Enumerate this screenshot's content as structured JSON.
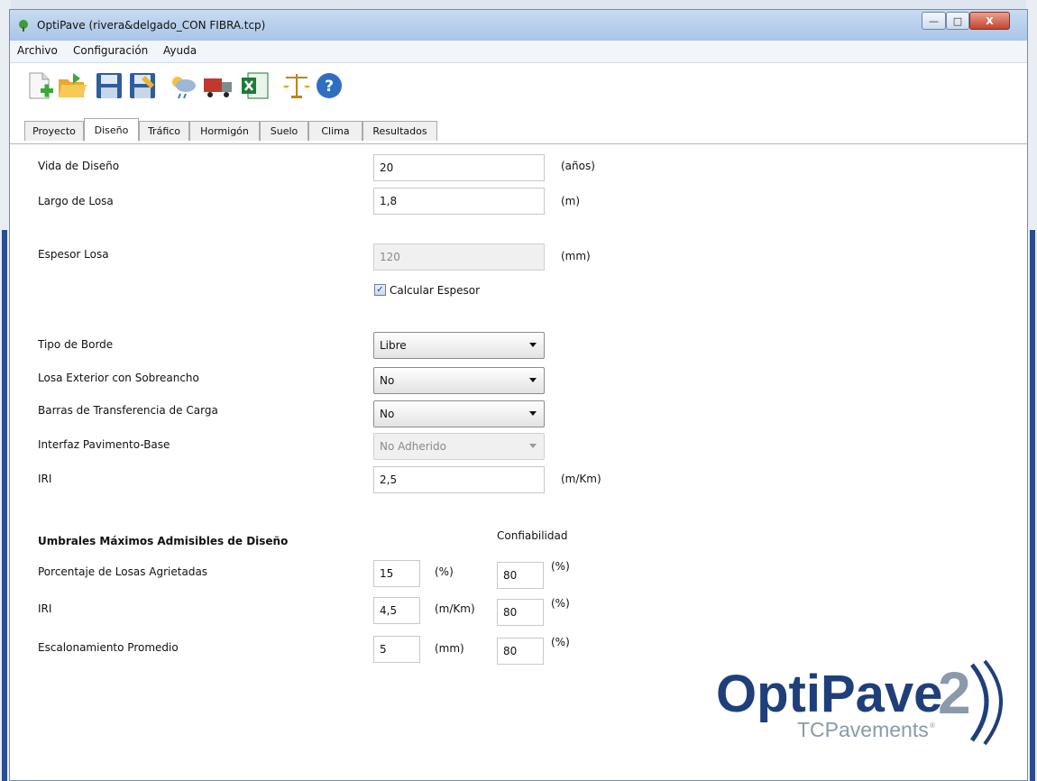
{
  "window": {
    "title": "OptiPave  (rivera&delgado_CON FIBRA.tcp)",
    "min": "—",
    "max": "□",
    "close": "X"
  },
  "menu": [
    "Archivo",
    "Configuración",
    "Ayuda"
  ],
  "toolbar": {
    "icons": [
      "new-file-icon",
      "open-folder-icon",
      "save-icon",
      "save-as-icon",
      "weather-icon",
      "truck-icon",
      "excel-icon",
      "scale-icon",
      "help-icon"
    ]
  },
  "tabs": [
    "Proyecto",
    "Diseño",
    "Tráfico",
    "Hormigón",
    "Suelo",
    "Clima",
    "Resultados"
  ],
  "active_tab": "Diseño",
  "design": {
    "vida": {
      "label": "Vida de Diseño",
      "value": "20",
      "unit": "(años)"
    },
    "largo": {
      "label": "Largo de Losa",
      "value": "1,8",
      "unit": "(m)"
    },
    "espesor": {
      "label": "Espesor Losa",
      "value": "120",
      "unit": "(mm)"
    },
    "calcular": {
      "label": "Calcular Espesor",
      "checked": true
    },
    "tipo_borde": {
      "label": "Tipo de Borde",
      "value": "Libre"
    },
    "sobreancho": {
      "label": "Losa Exterior con Sobreancho",
      "value": "No"
    },
    "barras": {
      "label": "Barras de Transferencia de Carga",
      "value": "No"
    },
    "interfaz": {
      "label": "Interfaz Pavimento-Base",
      "value": "No Adherido"
    },
    "iri": {
      "label": "IRI",
      "value": "2,5",
      "unit": "(m/Km)"
    }
  },
  "thresholds": {
    "heading": "Umbrales Máximos Admisibles de Diseño",
    "confiabilidad_label": "Confiabilidad",
    "rows": [
      {
        "label": "Porcentaje de Losas Agrietadas",
        "value": "15",
        "unit": "(%)",
        "conf": "80",
        "conf_unit": "(%)"
      },
      {
        "label": "IRI",
        "value": "4,5",
        "unit": "(m/Km)",
        "conf": "80",
        "conf_unit": "(%)"
      },
      {
        "label": "Escalonamiento Promedio",
        "value": "5",
        "unit": "(mm)",
        "conf": "80",
        "conf_unit": "(%)"
      }
    ]
  },
  "logo": {
    "name": "OptiPave",
    "version": "2",
    "company": "TCPavements",
    "mark": "®"
  },
  "colors": {
    "logo_blue": "#1f3f7a",
    "logo_gray": "#8a9aab",
    "title_bar": "#b9d1ee"
  }
}
